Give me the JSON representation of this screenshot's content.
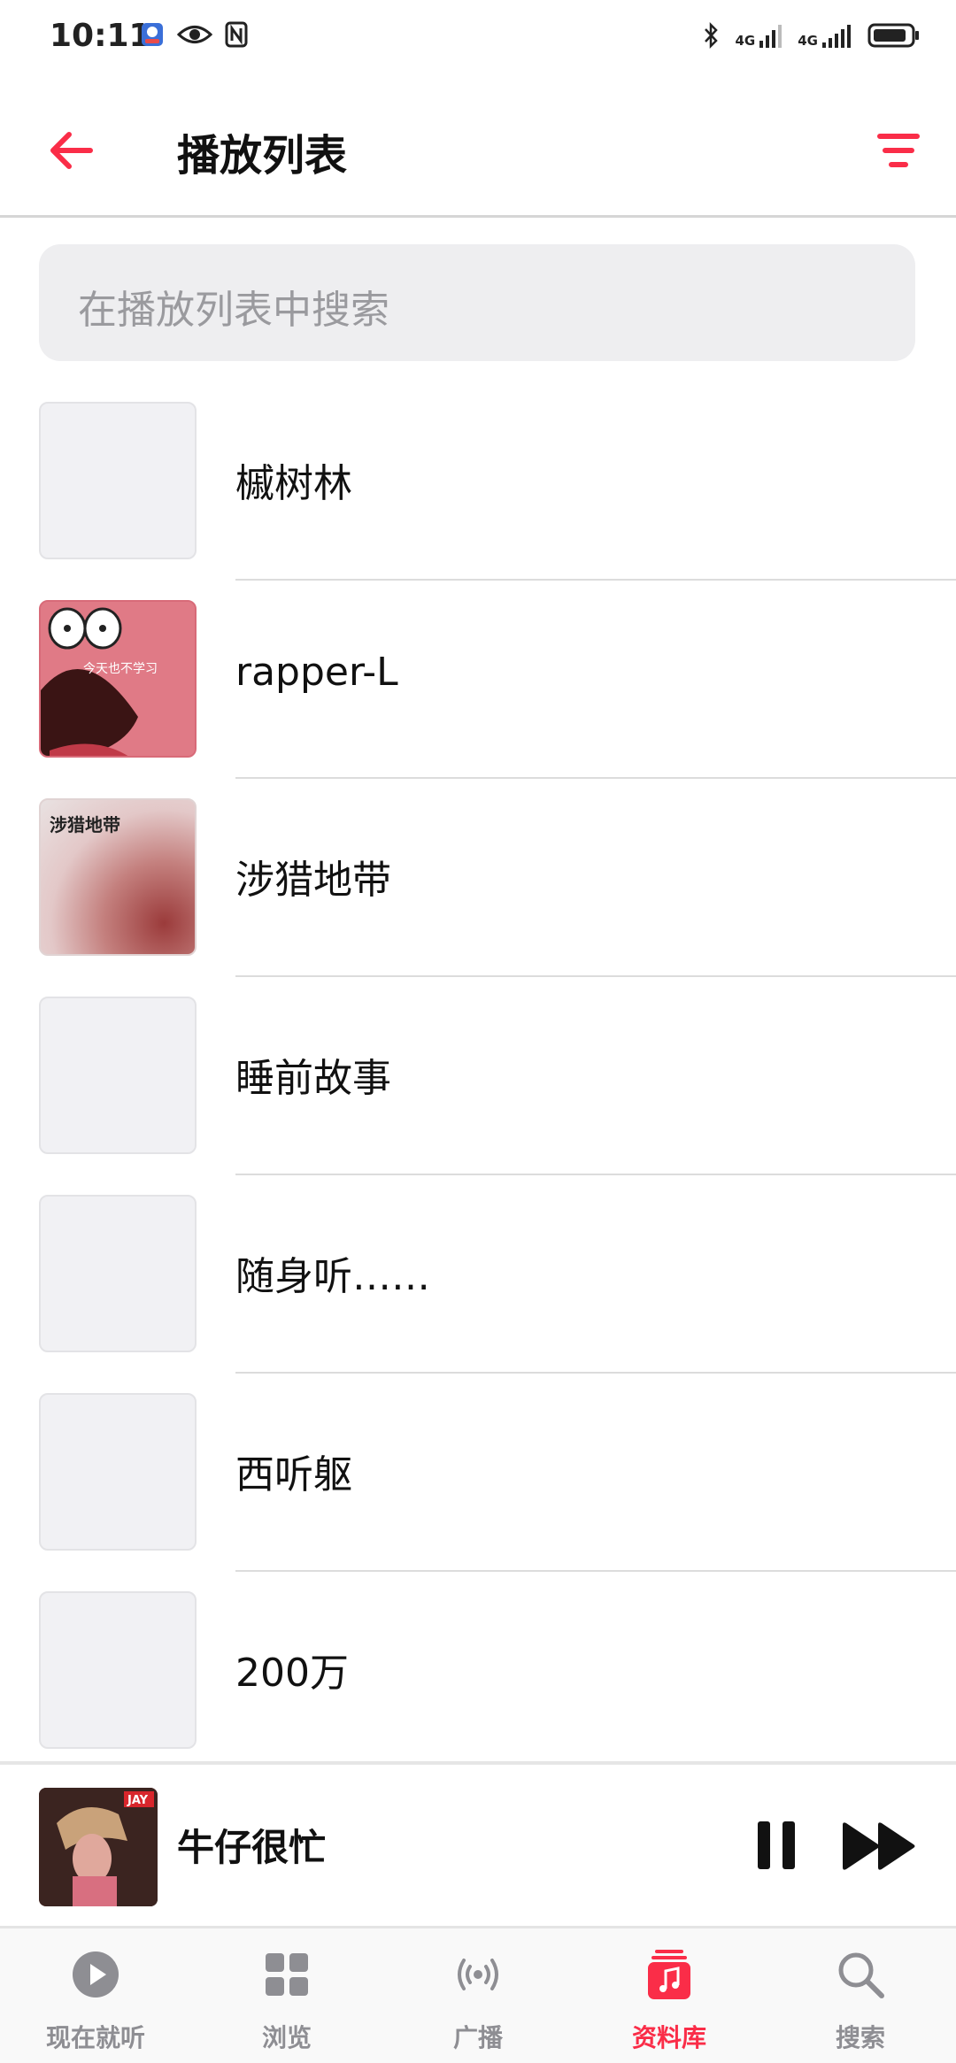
{
  "status_bar": {
    "time": "10:11",
    "signal_1": "4G",
    "signal_2": "4G"
  },
  "header": {
    "title": "播放列表"
  },
  "search": {
    "placeholder": "在播放列表中搜索"
  },
  "playlists": [
    {
      "name": "槭树林",
      "art": "placeholder"
    },
    {
      "name": "rapper-L",
      "art": "cartoon",
      "art_text": "今天也不学习"
    },
    {
      "name": "涉猎地带",
      "art": "blur",
      "art_text": "涉猎地带"
    },
    {
      "name": "睡前故事",
      "art": "placeholder"
    },
    {
      "name": "随身听……",
      "art": "placeholder"
    },
    {
      "name": "西听躯",
      "art": "placeholder"
    },
    {
      "name": "200万",
      "art": "placeholder"
    }
  ],
  "now_playing": {
    "title": "牛仔很忙",
    "art_badge": "JAY"
  },
  "tabs": [
    {
      "label": "现在就听",
      "icon": "play-circle-icon"
    },
    {
      "label": "浏览",
      "icon": "grid-icon"
    },
    {
      "label": "广播",
      "icon": "radio-broadcast-icon"
    },
    {
      "label": "资料库",
      "icon": "music-library-icon",
      "active": true
    },
    {
      "label": "搜索",
      "icon": "search-icon"
    }
  ],
  "colors": {
    "accent": "#fa2d48",
    "inactive": "#8e8e93",
    "placeholder_bg": "#f1f1f4"
  }
}
